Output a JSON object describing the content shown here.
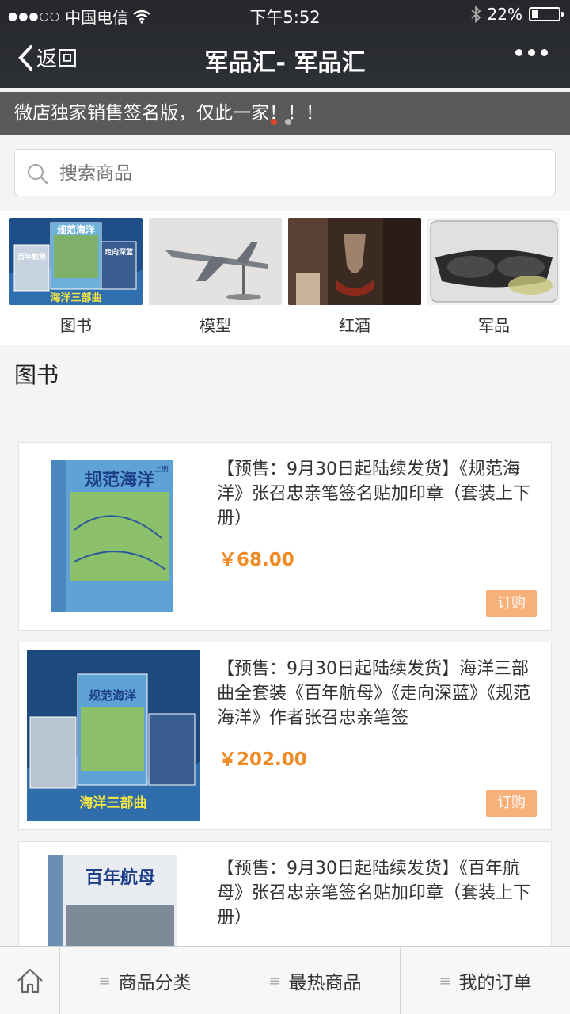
{
  "status_bar": {
    "carrier": "中国电信",
    "time": "下午5:52",
    "battery": "22%",
    "battery_level": 0.22
  },
  "navbar": {
    "back_label": "返回",
    "title": "军品汇- 军品汇"
  },
  "banner": {
    "text": "微店独家销售签名版，仅此一家！！！"
  },
  "search": {
    "placeholder": "搜索商品"
  },
  "categories": [
    {
      "label": "图书"
    },
    {
      "label": "模型"
    },
    {
      "label": "红酒"
    },
    {
      "label": "军品"
    }
  ],
  "section": {
    "title": "图书"
  },
  "products": [
    {
      "name": "【预售：9月30日起陆续发货】《规范海洋》张召忠亲笔签名贴加印章（套装上下册）",
      "price": "￥68.00",
      "buy_label": "订购",
      "cover_title": "规范海洋",
      "cover_tag": "上册"
    },
    {
      "name": "【预售：9月30日起陆续发货】海洋三部曲全套装《百年航母》《走向深蓝》《规范海洋》作者张召忠亲笔签",
      "price": "￥202.00",
      "buy_label": "订购",
      "cover_title": "规范海洋",
      "cover_sub": "海洋三部曲"
    },
    {
      "name": "【预售：9月30日起陆续发货】《百年航母》张召忠亲笔签名贴加印章（套装上下册）",
      "price": "",
      "buy_label": "",
      "cover_title": "百年航母"
    }
  ],
  "tabbar": {
    "home_icon": "home-icon",
    "tabs": [
      {
        "label": "商品分类"
      },
      {
        "label": "最热商品"
      },
      {
        "label": "我的订单"
      }
    ]
  },
  "colors": {
    "price": "#f08a24",
    "buy_button": "#f7b07a",
    "topbar": "#2a2c31"
  }
}
